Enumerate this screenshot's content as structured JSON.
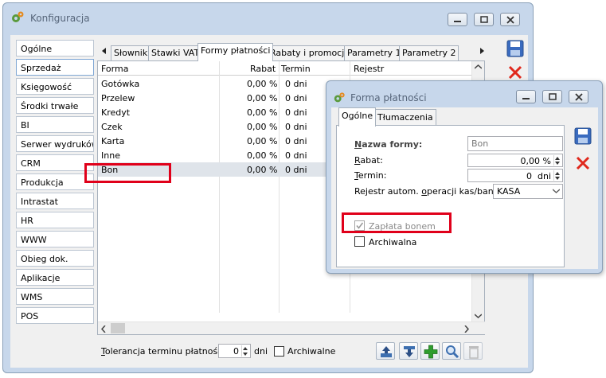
{
  "main_window": {
    "title": "Konfiguracja",
    "nav_items": [
      "Ogólne",
      "Sprzedaż",
      "Księgowość",
      "Środki trwałe",
      "BI",
      "Serwer wydruków",
      "CRM",
      "Produkcja",
      "Intrastat",
      "HR",
      "WWW",
      "Obieg dok.",
      "Aplikacje",
      "WMS",
      "POS"
    ],
    "tabs": [
      "Słowniki",
      "Stawki VAT",
      "Formy płatności",
      "Rabaty i promocje",
      "Parametry 1",
      "Parametry 2"
    ],
    "table": {
      "columns": [
        "Forma",
        "Rabat",
        "Termin",
        "Rejestr"
      ],
      "rows": [
        {
          "forma": "Gotówka",
          "rabat": "0,00 %",
          "termin": "0 dni"
        },
        {
          "forma": "Przelew",
          "rabat": "0,00 %",
          "termin": "0 dni"
        },
        {
          "forma": "Kredyt",
          "rabat": "0,00 %",
          "termin": "0 dni"
        },
        {
          "forma": "Czek",
          "rabat": "0,00 %",
          "termin": "0 dni"
        },
        {
          "forma": "Karta",
          "rabat": "0,00 %",
          "termin": "0 dni"
        },
        {
          "forma": "Inne",
          "rabat": "0,00 %",
          "termin": "0 dni"
        },
        {
          "forma": "Bon",
          "rabat": "0,00 %",
          "termin": "0 dni"
        }
      ]
    },
    "footer": {
      "tolerance_label_u": "T",
      "tolerance_label_rest": "olerancja terminu płatności:",
      "tolerance_value": "0",
      "tolerance_unit": "dni",
      "archived_label": "Archiwalne"
    }
  },
  "dialog": {
    "title": "Forma płatności",
    "tabs": [
      "Ogólne",
      "Tłumaczenia"
    ],
    "nazwa_label_u": "N",
    "nazwa_label_rest": "azwa formy:",
    "nazwa_value": "Bon",
    "rabat_label_u": "R",
    "rabat_label_rest": "abat:",
    "rabat_value": "0,00 %",
    "termin_label_u": "T",
    "termin_label_rest": "ermin:",
    "termin_value": "0",
    "termin_unit": "dni",
    "rejestr_label_pre": "Rejestr autom. ",
    "rejestr_label_u": "o",
    "rejestr_label_post": "peracji kas/bank:",
    "rejestr_value": "KASA",
    "zaplata_label": "Zapłata bonem",
    "archiwalna_label": "Archiwalna"
  }
}
